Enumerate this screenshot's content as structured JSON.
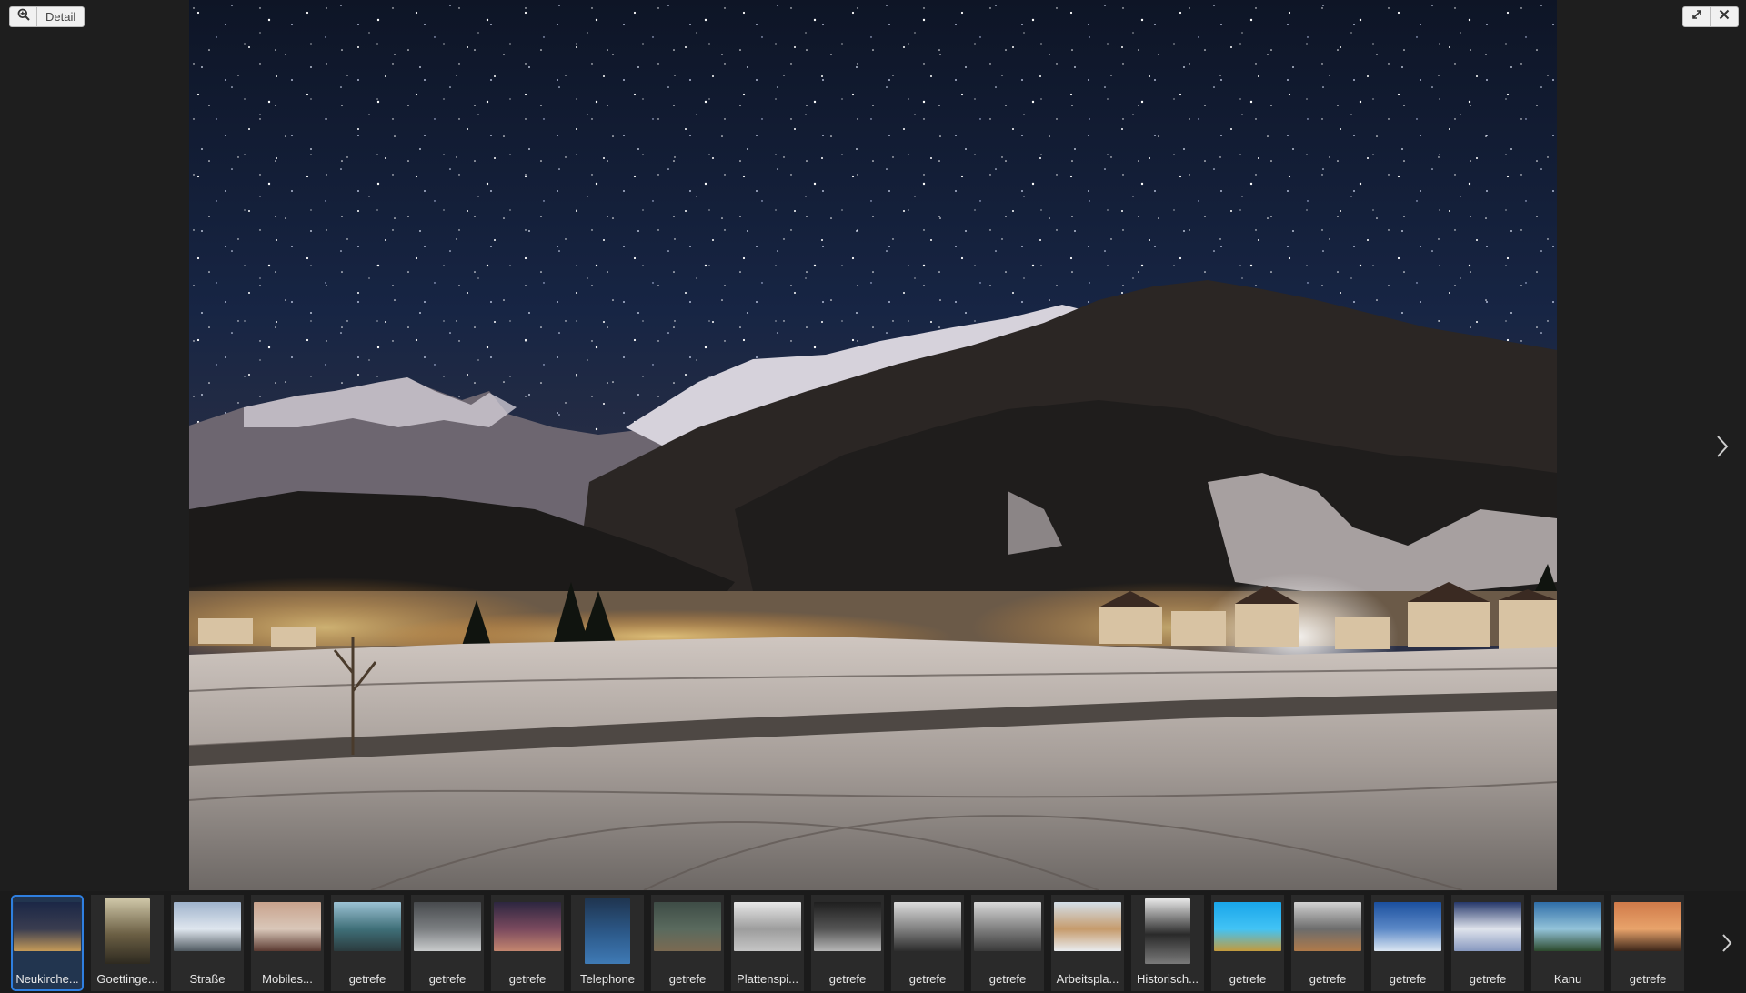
{
  "toolbar_left": {
    "detail_label": "Detail",
    "zoom_icon": "zoom-in-icon"
  },
  "toolbar_right": {
    "fullscreen_icon": "expand-icon",
    "close_icon": "close-icon"
  },
  "viewer": {
    "next_icon": "chevron-right-icon",
    "photo": "night-winter-village-mountains-stars"
  },
  "filmstrip": {
    "next_icon": "chevron-right-icon",
    "items": [
      {
        "label": "Neukirche...",
        "active": true,
        "colors": [
          "#1b2746",
          "#3a3d50",
          "#c59b58"
        ]
      },
      {
        "label": "Goettinge...",
        "tall": true,
        "colors": [
          "#cfc7a8",
          "#6b5f44",
          "#2e2a20"
        ]
      },
      {
        "label": "Straße",
        "colors": [
          "#9fb3cc",
          "#dfe6ee",
          "#505a61"
        ]
      },
      {
        "label": "Mobiles...",
        "colors": [
          "#c9a38d",
          "#d9c7b9",
          "#5b3a31"
        ]
      },
      {
        "label": "getrefe",
        "colors": [
          "#9cc2d4",
          "#3f6f78",
          "#2b3b3e"
        ]
      },
      {
        "label": "getrefe",
        "colors": [
          "#474a4d",
          "#7c7f82",
          "#c9cbcc"
        ]
      },
      {
        "label": "getrefe",
        "colors": [
          "#2d2640",
          "#7b4a5e",
          "#c4866f"
        ]
      },
      {
        "label": "Telephone",
        "tall": true,
        "colors": [
          "#1f3550",
          "#2d5b8c",
          "#3f7ab5"
        ]
      },
      {
        "label": "getrefe",
        "colors": [
          "#3e4c46",
          "#5a6a5e",
          "#7b6a52"
        ]
      },
      {
        "label": "Plattenspi...",
        "colors": [
          "#e7e7e7",
          "#9d9d9d",
          "#c5c5c5"
        ]
      },
      {
        "label": "getrefe",
        "colors": [
          "#1f1f1f",
          "#555555",
          "#b6b6b6"
        ]
      },
      {
        "label": "getrefe",
        "colors": [
          "#dcdcdc",
          "#808080",
          "#2d2d2d"
        ]
      },
      {
        "label": "getrefe",
        "colors": [
          "#d9d9d9",
          "#7f7f7f",
          "#3a3a3a"
        ]
      },
      {
        "label": "Arbeitspla...",
        "colors": [
          "#d4dfe9",
          "#c69b6c",
          "#e9ecef"
        ]
      },
      {
        "label": "Historisch...",
        "tall": true,
        "colors": [
          "#e9e9e9",
          "#2a2a2a",
          "#7a7a7a"
        ]
      },
      {
        "label": "getrefe",
        "colors": [
          "#19a6ea",
          "#42c3f5",
          "#c49b3c"
        ]
      },
      {
        "label": "getrefe",
        "colors": [
          "#d2d2d2",
          "#6c6c6c",
          "#b07a4a"
        ]
      },
      {
        "label": "getrefe",
        "colors": [
          "#1b4f9e",
          "#5c89c7",
          "#dbe6f2"
        ]
      },
      {
        "label": "getrefe",
        "colors": [
          "#26386b",
          "#dfe3ec",
          "#8798bf"
        ]
      },
      {
        "label": "Kanu",
        "colors": [
          "#2f6ea8",
          "#93c3d9",
          "#2c4a2c"
        ]
      },
      {
        "label": "getrefe",
        "colors": [
          "#d07a49",
          "#e8a36b",
          "#3c2619"
        ]
      }
    ]
  }
}
